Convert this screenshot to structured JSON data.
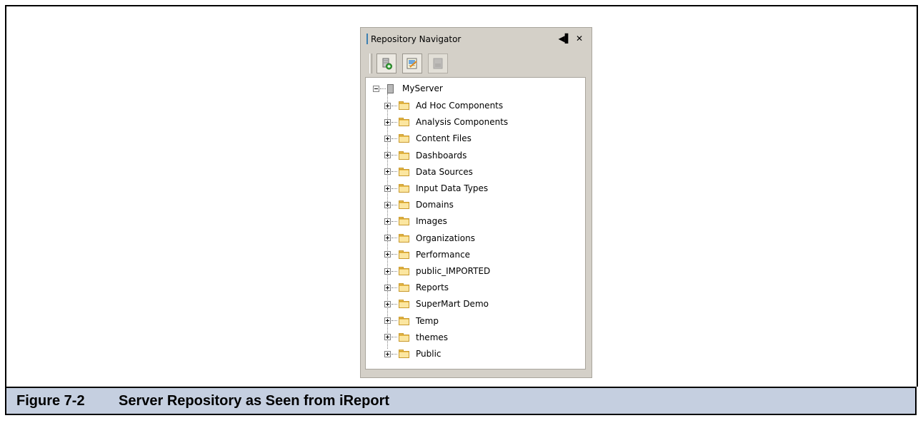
{
  "panel": {
    "title": "Repository Navigator",
    "minimize_glyph": "◀▌",
    "close_glyph": "✕"
  },
  "toolbar": {
    "buttons": [
      {
        "icon": "add-server-icon",
        "enabled": true
      },
      {
        "icon": "edit-server-icon",
        "enabled": true
      },
      {
        "icon": "delete-server-icon",
        "enabled": false
      }
    ]
  },
  "tree": {
    "root": "MyServer",
    "items": [
      "Ad Hoc Components",
      "Analysis Components",
      "Content Files",
      "Dashboards",
      "Data Sources",
      "Input Data Types",
      "Domains",
      "Images",
      "Organizations",
      "Performance",
      "public_IMPORTED",
      "Reports",
      "SuperMart Demo",
      "Temp",
      "themes",
      "Public"
    ]
  },
  "caption": {
    "number": "Figure 7-2",
    "title": "Server Repository as Seen from iReport"
  },
  "colors": {
    "caption_bg": "#c5cfe0",
    "panel_bg": "#d4d0c8",
    "folder": "#f0c350"
  }
}
